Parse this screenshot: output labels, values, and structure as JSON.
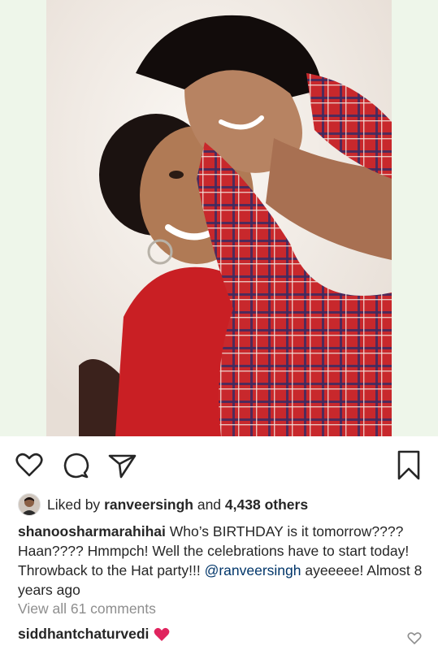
{
  "post": {
    "liked_by_prefix": "Liked by",
    "liked_by_user": "ranveersingh",
    "liked_by_and": "and",
    "liked_by_count": "4,438 others",
    "caption_user": "shanoosharmarahihai",
    "caption_text_1": "Who’s BIRTHDAY is it tomorrow???? Haan???? Hmmpch! Well the celebrations have to start today! Throwback to the Hat party!!!",
    "caption_mention": "@ranveersingh",
    "caption_text_2": "ayeeeee! Almost 8 years ago",
    "view_all": "View all 61 comments"
  },
  "comment": {
    "user": "siddhantchaturvedi"
  },
  "icons": {
    "like": "heart-outline-icon",
    "comment": "speech-bubble-icon",
    "share": "paper-plane-icon",
    "save": "bookmark-icon",
    "comment_like": "small-heart-outline-icon",
    "emoji": "red-heart-emoji"
  },
  "colors": {
    "text": "#262626",
    "muted": "#8e8e8e",
    "mention": "#003569",
    "emoji_heart": "#e0245e"
  }
}
